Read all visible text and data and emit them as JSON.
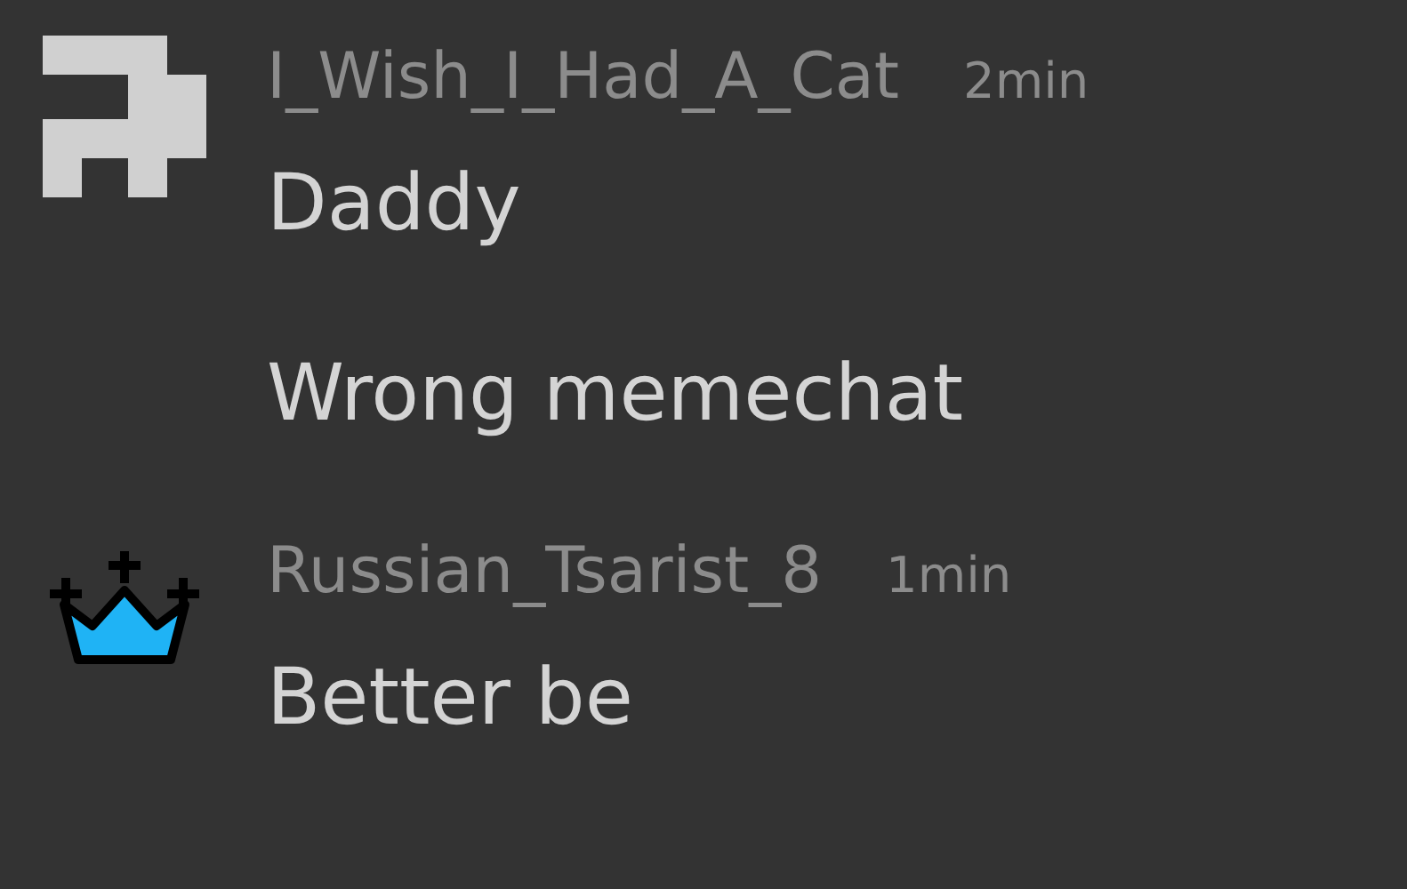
{
  "messages": [
    {
      "kind": "pixel",
      "username": "I_Wish_I_Had_A_Cat",
      "time": "2min",
      "lines": [
        "Daddy",
        "Wrong memechat"
      ]
    },
    {
      "kind": "crown",
      "username": "Russian_Tsarist_8",
      "time": "1min",
      "lines": [
        "Better be"
      ]
    }
  ]
}
